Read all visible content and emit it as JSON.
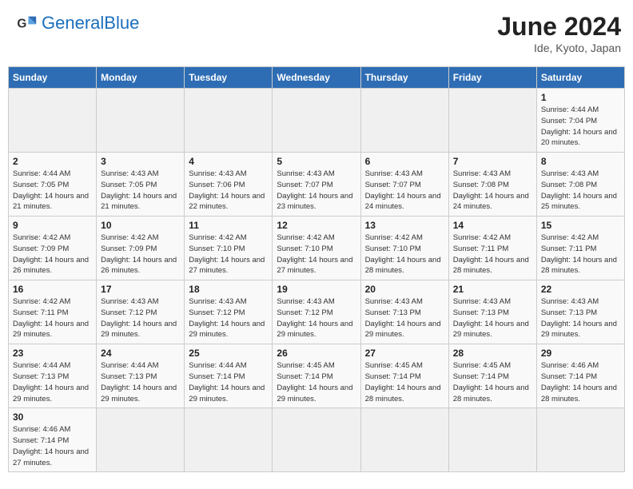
{
  "header": {
    "logo_general": "General",
    "logo_blue": "Blue",
    "month_year": "June 2024",
    "location": "Ide, Kyoto, Japan"
  },
  "days_of_week": [
    "Sunday",
    "Monday",
    "Tuesday",
    "Wednesday",
    "Thursday",
    "Friday",
    "Saturday"
  ],
  "weeks": [
    [
      {
        "day": null,
        "info": null
      },
      {
        "day": null,
        "info": null
      },
      {
        "day": null,
        "info": null
      },
      {
        "day": null,
        "info": null
      },
      {
        "day": null,
        "info": null
      },
      {
        "day": null,
        "info": null
      },
      {
        "day": "1",
        "info": "Sunrise: 4:44 AM\nSunset: 7:04 PM\nDaylight: 14 hours\nand 20 minutes."
      }
    ],
    [
      {
        "day": "2",
        "info": "Sunrise: 4:44 AM\nSunset: 7:05 PM\nDaylight: 14 hours\nand 21 minutes."
      },
      {
        "day": "3",
        "info": "Sunrise: 4:43 AM\nSunset: 7:05 PM\nDaylight: 14 hours\nand 21 minutes."
      },
      {
        "day": "4",
        "info": "Sunrise: 4:43 AM\nSunset: 7:06 PM\nDaylight: 14 hours\nand 22 minutes."
      },
      {
        "day": "5",
        "info": "Sunrise: 4:43 AM\nSunset: 7:07 PM\nDaylight: 14 hours\nand 23 minutes."
      },
      {
        "day": "6",
        "info": "Sunrise: 4:43 AM\nSunset: 7:07 PM\nDaylight: 14 hours\nand 24 minutes."
      },
      {
        "day": "7",
        "info": "Sunrise: 4:43 AM\nSunset: 7:08 PM\nDaylight: 14 hours\nand 24 minutes."
      },
      {
        "day": "8",
        "info": "Sunrise: 4:43 AM\nSunset: 7:08 PM\nDaylight: 14 hours\nand 25 minutes."
      }
    ],
    [
      {
        "day": "9",
        "info": "Sunrise: 4:42 AM\nSunset: 7:09 PM\nDaylight: 14 hours\nand 26 minutes."
      },
      {
        "day": "10",
        "info": "Sunrise: 4:42 AM\nSunset: 7:09 PM\nDaylight: 14 hours\nand 26 minutes."
      },
      {
        "day": "11",
        "info": "Sunrise: 4:42 AM\nSunset: 7:10 PM\nDaylight: 14 hours\nand 27 minutes."
      },
      {
        "day": "12",
        "info": "Sunrise: 4:42 AM\nSunset: 7:10 PM\nDaylight: 14 hours\nand 27 minutes."
      },
      {
        "day": "13",
        "info": "Sunrise: 4:42 AM\nSunset: 7:10 PM\nDaylight: 14 hours\nand 28 minutes."
      },
      {
        "day": "14",
        "info": "Sunrise: 4:42 AM\nSunset: 7:11 PM\nDaylight: 14 hours\nand 28 minutes."
      },
      {
        "day": "15",
        "info": "Sunrise: 4:42 AM\nSunset: 7:11 PM\nDaylight: 14 hours\nand 28 minutes."
      }
    ],
    [
      {
        "day": "16",
        "info": "Sunrise: 4:42 AM\nSunset: 7:11 PM\nDaylight: 14 hours\nand 29 minutes."
      },
      {
        "day": "17",
        "info": "Sunrise: 4:43 AM\nSunset: 7:12 PM\nDaylight: 14 hours\nand 29 minutes."
      },
      {
        "day": "18",
        "info": "Sunrise: 4:43 AM\nSunset: 7:12 PM\nDaylight: 14 hours\nand 29 minutes."
      },
      {
        "day": "19",
        "info": "Sunrise: 4:43 AM\nSunset: 7:12 PM\nDaylight: 14 hours\nand 29 minutes."
      },
      {
        "day": "20",
        "info": "Sunrise: 4:43 AM\nSunset: 7:13 PM\nDaylight: 14 hours\nand 29 minutes."
      },
      {
        "day": "21",
        "info": "Sunrise: 4:43 AM\nSunset: 7:13 PM\nDaylight: 14 hours\nand 29 minutes."
      },
      {
        "day": "22",
        "info": "Sunrise: 4:43 AM\nSunset: 7:13 PM\nDaylight: 14 hours\nand 29 minutes."
      }
    ],
    [
      {
        "day": "23",
        "info": "Sunrise: 4:44 AM\nSunset: 7:13 PM\nDaylight: 14 hours\nand 29 minutes."
      },
      {
        "day": "24",
        "info": "Sunrise: 4:44 AM\nSunset: 7:13 PM\nDaylight: 14 hours\nand 29 minutes."
      },
      {
        "day": "25",
        "info": "Sunrise: 4:44 AM\nSunset: 7:14 PM\nDaylight: 14 hours\nand 29 minutes."
      },
      {
        "day": "26",
        "info": "Sunrise: 4:45 AM\nSunset: 7:14 PM\nDaylight: 14 hours\nand 29 minutes."
      },
      {
        "day": "27",
        "info": "Sunrise: 4:45 AM\nSunset: 7:14 PM\nDaylight: 14 hours\nand 28 minutes."
      },
      {
        "day": "28",
        "info": "Sunrise: 4:45 AM\nSunset: 7:14 PM\nDaylight: 14 hours\nand 28 minutes."
      },
      {
        "day": "29",
        "info": "Sunrise: 4:46 AM\nSunset: 7:14 PM\nDaylight: 14 hours\nand 28 minutes."
      }
    ],
    [
      {
        "day": "30",
        "info": "Sunrise: 4:46 AM\nSunset: 7:14 PM\nDaylight: 14 hours\nand 27 minutes."
      },
      {
        "day": null,
        "info": null
      },
      {
        "day": null,
        "info": null
      },
      {
        "day": null,
        "info": null
      },
      {
        "day": null,
        "info": null
      },
      {
        "day": null,
        "info": null
      },
      {
        "day": null,
        "info": null
      }
    ]
  ]
}
